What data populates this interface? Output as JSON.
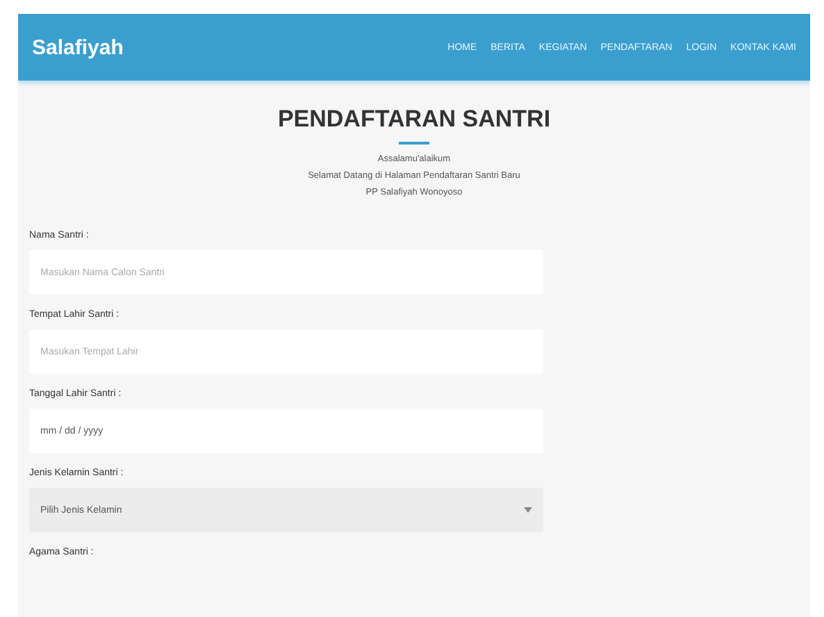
{
  "navbar": {
    "brand": "Salafiyah",
    "links": [
      "HOME",
      "BERITA",
      "KEGIATAN",
      "PENDAFTARAN",
      "LOGIN",
      "KONTAK KAMI"
    ]
  },
  "header": {
    "title": "PENDAFTARAN SANTRI",
    "lines": [
      "Assalamu'alaikum",
      "Selamat Datang di Halaman Pendaftaran Santri Baru",
      "PP Salafiyah Wonoyoso"
    ]
  },
  "form": {
    "fields": [
      {
        "kind": "text",
        "label": "Nama Santri :",
        "placeholder": "Masukan Nama Calon Santri"
      },
      {
        "kind": "text",
        "label": "Tempat Lahir Santri :",
        "placeholder": "Masukan Tempat Lahir"
      },
      {
        "kind": "date",
        "label": "Tanggal Lahir Santri :",
        "value": "mm / dd / yyyy"
      },
      {
        "kind": "select",
        "label": "Jenis Kelamin Santri :",
        "value": "Pilih Jenis Kelamin"
      },
      {
        "kind": "label",
        "label": "Agama Santri :"
      }
    ]
  }
}
